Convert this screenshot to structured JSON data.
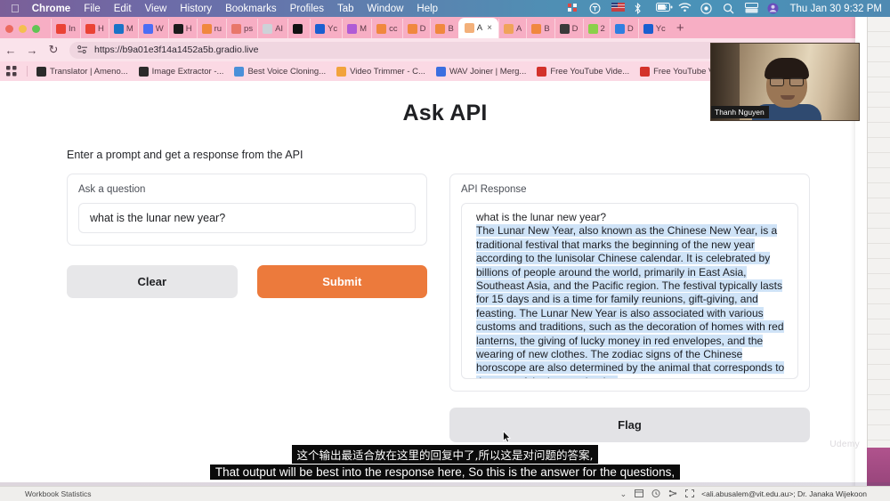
{
  "menubar": {
    "apple_icon": "apple-icon",
    "items": [
      "Chrome",
      "File",
      "Edit",
      "View",
      "History",
      "Bookmarks",
      "Profiles",
      "Tab",
      "Window",
      "Help"
    ],
    "status_icons": [
      "grid-red-icon",
      "circle-t-icon",
      "flag-icon",
      "bluetooth-icon",
      "battery-icon",
      "wifi-icon",
      "control-center-icon",
      "search-icon",
      "display-icon",
      "user-icon"
    ],
    "clock": "Thu Jan 30  9:32 PM"
  },
  "browser": {
    "tabs": [
      {
        "label": "In",
        "color": "#ea4335"
      },
      {
        "label": "H",
        "color": "#ea4335"
      },
      {
        "label": "M",
        "color": "#1a73c7"
      },
      {
        "label": "W",
        "color": "#4c6ef5"
      },
      {
        "label": "H",
        "color": "#1b1b1b"
      },
      {
        "label": "ru",
        "color": "#f0883e"
      },
      {
        "label": "ps",
        "color": "#e8776a"
      },
      {
        "label": "AI",
        "color": "#cdd2d8"
      },
      {
        "label": "",
        "color": "#111111"
      },
      {
        "label": "Yc",
        "color": "#1a5fd0"
      },
      {
        "label": "M",
        "color": "#b05bd6"
      },
      {
        "label": "cc",
        "color": "#f0883e"
      },
      {
        "label": "D",
        "color": "#f0883e"
      },
      {
        "label": "B",
        "color": "#f0883e"
      },
      {
        "label": "A",
        "color": "#f3b07a",
        "active": true
      },
      {
        "label": "A",
        "color": "#f0a35a"
      },
      {
        "label": "B",
        "color": "#f0883e"
      },
      {
        "label": "D",
        "color": "#3a3a3a"
      },
      {
        "label": "2",
        "color": "#8bd04a"
      },
      {
        "label": "D",
        "color": "#2f7fe0"
      },
      {
        "label": "Yc",
        "color": "#1a5fd0"
      }
    ],
    "new_tab_label": "+",
    "tab_close_label": "×",
    "tab_list_chevron": "⌄",
    "nav": {
      "back": "←",
      "forward": "→",
      "reload": "↻"
    },
    "url": "https://b9a01e3f14a1452a5b.gradio.live",
    "site_settings_icon": "site-settings-icon",
    "bookmarks": [
      {
        "label": "Translator | Ameno...",
        "color": "#2b2b2b"
      },
      {
        "label": "Image Extractor -...",
        "color": "#2b2b2b"
      },
      {
        "label": "Best Voice Cloning...",
        "color": "#4a90d9"
      },
      {
        "label": "Video Trimmer - C...",
        "color": "#f2a33c"
      },
      {
        "label": "WAV Joiner | Merg...",
        "color": "#3b6fe0"
      },
      {
        "label": "Free YouTube Vide...",
        "color": "#d3322b"
      },
      {
        "label": "Free YouTube Vide...",
        "color": "#d3322b"
      }
    ],
    "apps_icon": "apps-grid-icon"
  },
  "app": {
    "title": "Ask API",
    "subtitle": "Enter a prompt and get a response from the API",
    "input_panel": {
      "label": "Ask a question",
      "value": "what is the lunar new year?",
      "placeholder": ""
    },
    "buttons": {
      "clear": "Clear",
      "submit": "Submit",
      "flag": "Flag"
    },
    "response_panel": {
      "label": "API Response",
      "question_line": "what is the lunar new year?",
      "answer": "The Lunar New Year, also known as the Chinese New Year, is a traditional festival that marks the beginning of the new year according to the lunisolar Chinese calendar. It is celebrated by billions of people around the world, primarily in East Asia, Southeast Asia, and the Pacific region. The festival typically lasts for 15 days and is a time for family reunions, gift-giving, and feasting. The Lunar New Year is also associated with various customs and traditions, such as the decoration of homes with red lanterns, the giving of lucky money in red envelopes, and the wearing of new clothes. The zodiac signs of the Chinese horoscope are also determined by the animal that corresponds to the year of the lunar calendar."
    },
    "accent_color": "#ec7a3c",
    "selection_color": "#cfe3f7"
  },
  "webcam": {
    "name_label": "Thanh Nguyen"
  },
  "subtitles": {
    "chinese": "这个输出最适合放在这里的回复中了,所以这是对问题的答案,",
    "english": "That output will be best into the response here, So this is the answer for the questions,"
  },
  "watermark": "Udemy",
  "statusbar": {
    "left": "Workbook Statistics",
    "right": "<ali.abusalem@vit.edu.au>; Dr. Janaka Wijekoon",
    "icons": [
      "chevron-down-icon",
      "normal-view-icon",
      "page-layout-icon",
      "page-break-icon",
      "fullscreen-icon"
    ]
  }
}
